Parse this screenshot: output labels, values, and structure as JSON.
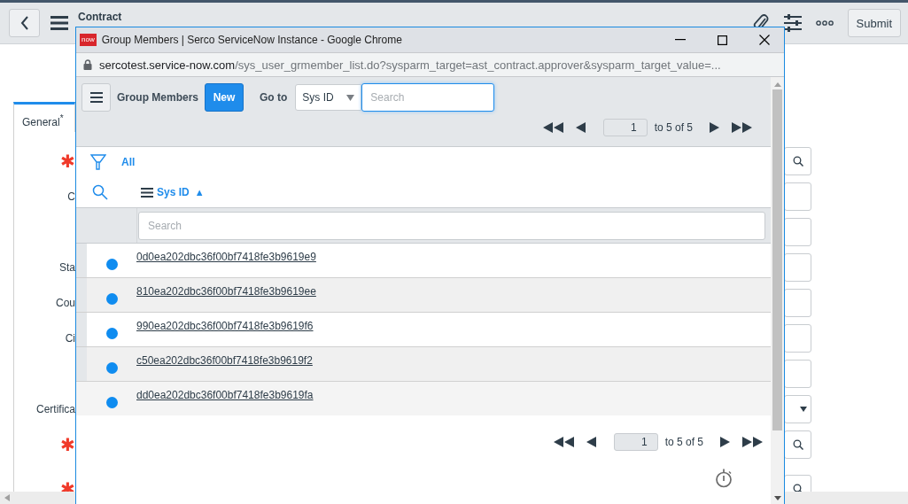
{
  "header": {
    "title": "Contract",
    "submit": "Submit"
  },
  "required_mark": "✱",
  "tabs": [
    {
      "label": "General$^{*}$",
      "selected": true
    }
  ],
  "form_rows": [
    {
      "required": true,
      "kind": "search"
    },
    {
      "label": "C",
      "required": false,
      "kind": "text"
    },
    {
      "required": false,
      "kind": "text"
    },
    {
      "label": "Sta",
      "required": false,
      "kind": "text"
    },
    {
      "label": "Cou",
      "required": false,
      "kind": "text"
    },
    {
      "label": "Ci",
      "required": false,
      "kind": "text"
    },
    {
      "required": false,
      "kind": "text"
    },
    {
      "label": "Certifica",
      "required": false,
      "kind": "select"
    },
    {
      "required": true,
      "kind": "search"
    },
    {
      "required": true,
      "kind": "search"
    }
  ],
  "popup": {
    "logo": "now",
    "title": "Group Members | Serco ServiceNow Instance - Google Chrome",
    "url_host": "sercotest.service-now.com",
    "url_path": "/sys_user_grmember_list.do?sysparm_target=ast_contract.approver&sysparm_target_value=...",
    "list_title": "Group Members",
    "new_button": "New",
    "goto_label": "Go to",
    "goto_field": "Sys ID",
    "search_placeholder": "Search",
    "pagination_top": {
      "page": "1",
      "range": "to 5 of 5"
    },
    "filter": "All",
    "column": {
      "label": "Sys ID",
      "sort_mark": "▲"
    },
    "column_search_placeholder": "Search",
    "rows": [
      {
        "sys_id": "0d0ea202dbc36f00bf7418fe3b9619e9"
      },
      {
        "sys_id": "810ea202dbc36f00bf7418fe3b9619ee"
      },
      {
        "sys_id": "990ea202dbc36f00bf7418fe3b9619f6"
      },
      {
        "sys_id": "c50ea202dbc36f00bf7418fe3b9619f2"
      },
      {
        "sys_id": "dd0ea202dbc36f00bf7418fe3b9619fa"
      }
    ],
    "pagination_bottom": {
      "page": "1",
      "range": "to 5 of 5"
    }
  }
}
